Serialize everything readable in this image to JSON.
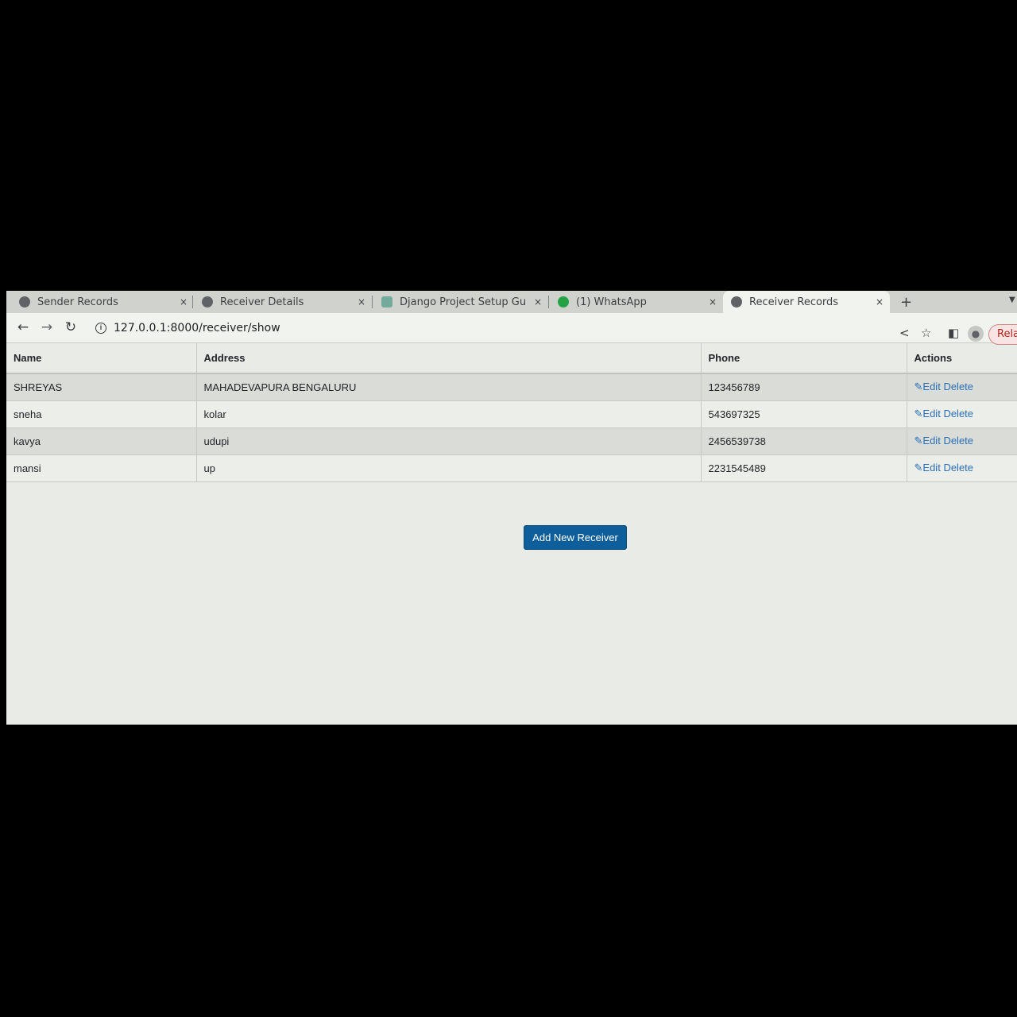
{
  "browser": {
    "tabs": [
      {
        "title": "Sender Records",
        "favicon": "globe-icon",
        "active": false
      },
      {
        "title": "Receiver Details",
        "favicon": "globe-icon",
        "active": false
      },
      {
        "title": "Django Project Setup Gu",
        "favicon": "django-icon",
        "active": false
      },
      {
        "title": "(1) WhatsApp",
        "favicon": "whatsapp-icon",
        "active": false
      },
      {
        "title": "Receiver Records",
        "favicon": "globe-icon",
        "active": true
      }
    ],
    "new_tab_label": "+",
    "close_glyph": "×",
    "url": "127.0.0.1:8000/receiver/show",
    "relaunch_label": "Relaunch"
  },
  "table": {
    "headers": {
      "name": "Name",
      "address": "Address",
      "phone": "Phone",
      "actions": "Actions"
    },
    "rows": [
      {
        "name": "SHREYAS",
        "address": "MAHADEVAPURA BENGALURU",
        "phone": "123456789"
      },
      {
        "name": "sneha",
        "address": "kolar",
        "phone": "543697325"
      },
      {
        "name": "kavya",
        "address": "udupi",
        "phone": "2456539738"
      },
      {
        "name": "mansi",
        "address": "up",
        "phone": "2231545489"
      }
    ],
    "edit_label": "Edit",
    "delete_label": "Delete"
  },
  "add_button_label": "Add New Receiver",
  "colors": {
    "primary_button": "#0d5e9a",
    "link": "#2b6fb6",
    "relaunch": "#b3261e"
  }
}
